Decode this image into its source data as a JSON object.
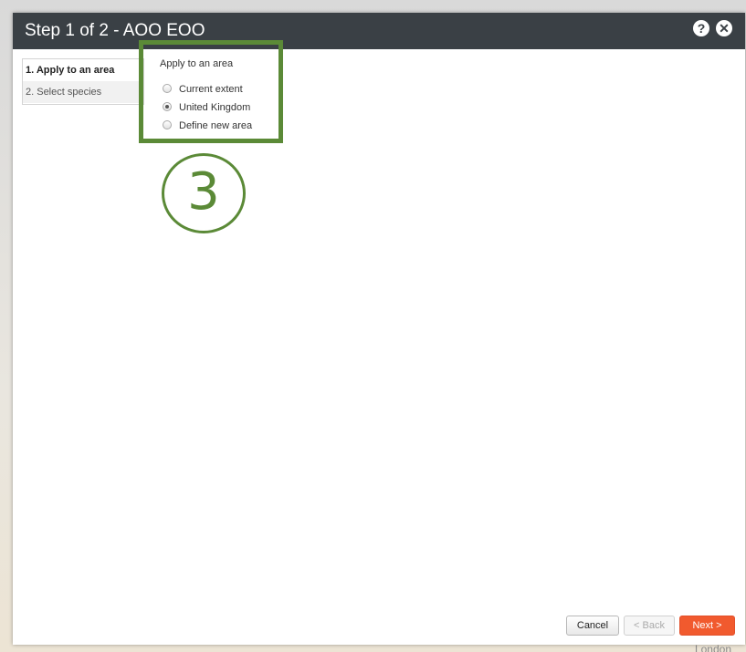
{
  "dialog": {
    "title": "Step 1 of 2 - AOO EOO",
    "help_icon": "help-icon",
    "close_icon": "close-icon"
  },
  "steps": [
    {
      "label": "1. Apply to an area",
      "active": true
    },
    {
      "label": "2. Select species",
      "active": false
    }
  ],
  "area_panel": {
    "title": "Apply to an area",
    "options": [
      {
        "label": "Current extent",
        "checked": false
      },
      {
        "label": "United Kingdom",
        "checked": true
      },
      {
        "label": "Define new area",
        "checked": false
      }
    ]
  },
  "callout": {
    "number": "3",
    "color": "#5b8a37"
  },
  "buttons": {
    "cancel": "Cancel",
    "back": "< Back",
    "next": "Next >"
  },
  "map": {
    "label": "London"
  },
  "colors": {
    "titlebar": "#3a4045",
    "next_button": "#f15a2e"
  }
}
